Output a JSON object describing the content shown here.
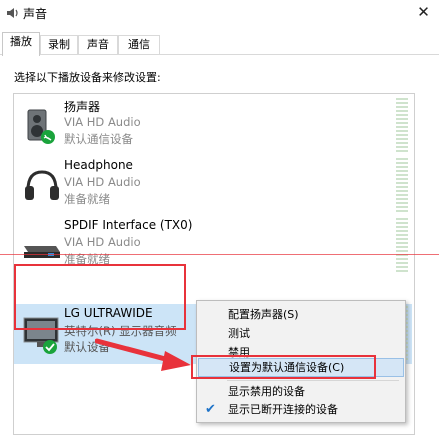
{
  "window": {
    "title": "声音",
    "close_symbol": "✕"
  },
  "tabs": [
    {
      "label": "播放",
      "active": true
    },
    {
      "label": "录制",
      "active": false
    },
    {
      "label": "声音",
      "active": false
    },
    {
      "label": "通信",
      "active": false
    }
  ],
  "panel": {
    "prompt": "选择以下播放设备来修改设置:"
  },
  "devices": [
    {
      "name": "扬声器",
      "driver": "VIA HD Audio",
      "status": "默认通信设备",
      "icon": "speaker-icon"
    },
    {
      "name": "Headphone",
      "driver": "VIA HD Audio",
      "status": "准备就绪",
      "icon": "headphone-icon"
    },
    {
      "name": "SPDIF Interface (TX0)",
      "driver": "VIA HD Audio",
      "status": "准备就绪",
      "icon": "spdif-device-icon"
    },
    {
      "name": "LG ULTRAWIDE",
      "driver": "英特尔(R) 显示器音频",
      "status": "默认设备",
      "icon": "monitor-icon",
      "selected": true
    }
  ],
  "context_menu": {
    "items": [
      {
        "label": "配置扬声器(S)"
      },
      {
        "label": "测试"
      },
      {
        "label": "禁用"
      },
      {
        "label": "设置为默认通信设备(C)",
        "highlighted": true
      },
      {
        "label": "显示禁用的设备"
      },
      {
        "label": "显示已断开连接的设备",
        "checked": true
      }
    ]
  },
  "colors": {
    "selection": "#cce4f7",
    "annotation_red": "#e8323b",
    "check_green": "#1aa33c"
  }
}
